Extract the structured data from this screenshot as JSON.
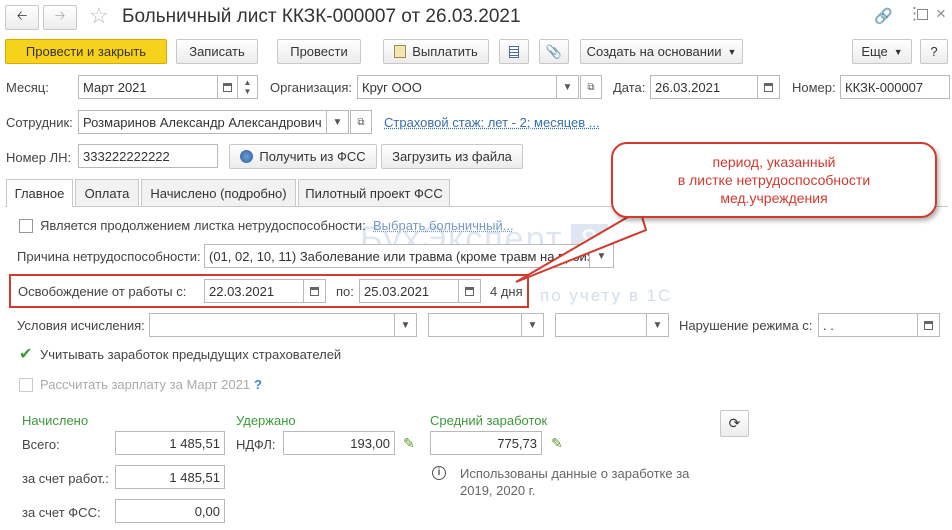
{
  "title": "Больничный лист ККЗК-000007 от 26.03.2021",
  "toolbar": {
    "post_close": "Провести и закрыть",
    "save": "Записать",
    "post": "Провести",
    "pay": "Выплатить",
    "create_based": "Создать на основании",
    "more": "Еще",
    "help": "?"
  },
  "form": {
    "month_label": "Месяц:",
    "month_value": "Март 2021",
    "org_label": "Организация:",
    "org_value": "Круг ООО",
    "date_label": "Дата:",
    "date_value": "26.03.2021",
    "number_label": "Номер:",
    "number_value": "ККЗК-000007",
    "employee_label": "Сотрудник:",
    "employee_value": "Розмаринов Александр Александрович",
    "insurance_link": "Страховой стаж: лет - 2; месяцев ...",
    "ln_label": "Номер ЛН:",
    "ln_value": "333222222222",
    "get_fss": "Получить из ФСС",
    "load_file": "Загрузить из файла"
  },
  "tabs": [
    "Главное",
    "Оплата",
    "Начислено (подробно)",
    "Пилотный проект ФСС"
  ],
  "main": {
    "continuation_label": "Является продолжением листка нетрудоспособности:",
    "choose_link": "Выбрать больничный...",
    "reason_label": "Причина нетрудоспособности:",
    "reason_value": "(01, 02, 10, 11) Заболевание или травма (кроме травм на произ",
    "release_label": "Освобождение от работы с:",
    "release_from": "22.03.2021",
    "to_label": "по:",
    "release_to": "25.03.2021",
    "days": "4 дня",
    "conditions_label": "Условия исчисления:",
    "violation_label": "Нарушение режима с:",
    "violation_value": " .  .",
    "prev_insurers_label": "Учитывать заработок предыдущих страхователей",
    "calc_salary_label": "Рассчитать зарплату за Март 2021",
    "calc_help": "?",
    "accrued_header": "Начислено",
    "total_label": "Всего:",
    "total_value": "1 485,51",
    "employer_label": "за счет работ.:",
    "employer_value": "1 485,51",
    "fss_label": "за счет ФСС:",
    "fss_value": "0,00",
    "withheld_header": "Удержано",
    "ndfl_label": "НДФЛ:",
    "ndfl_value": "193,00",
    "avg_header": "Средний заработок",
    "avg_value": "775,73",
    "info_text_1": "Использованы данные о заработке за",
    "info_text_2": "2019,  2020 г."
  },
  "callout": {
    "line1": "период, указанный",
    "line2": "в листке нетрудоспособности",
    "line3": "мед.учреждения"
  },
  "watermark": {
    "brand": "БухЭксперт",
    "num": "8",
    "sub": "по учету в 1С"
  },
  "colors": {
    "accent": "#f7d21a",
    "highlight": "#d23a2e",
    "green": "#3c9a3a"
  }
}
